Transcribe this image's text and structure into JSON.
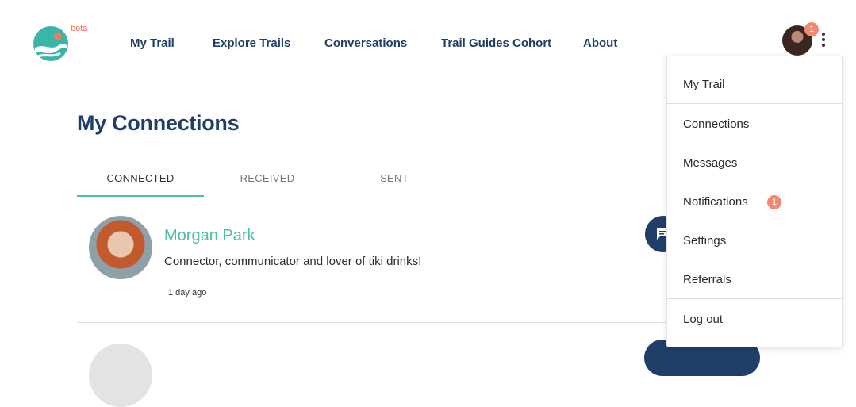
{
  "header": {
    "beta_label": "beta",
    "nav": [
      "My Trail",
      "Explore Trails",
      "Conversations",
      "Trail Guides Cohort",
      "About"
    ],
    "avatar_badge": "1"
  },
  "page": {
    "title": "My Connections",
    "tabs": [
      "CONNECTED",
      "RECEIVED",
      "SENT"
    ],
    "active_tab": "CONNECTED"
  },
  "connections": [
    {
      "name": "Morgan Park",
      "bio": "Connector, communicator and lover of tiki drinks!",
      "time": "1 day ago"
    }
  ],
  "menu": {
    "items": [
      "My Trail",
      "Connections",
      "Messages",
      "Notifications",
      "Settings",
      "Referrals",
      "Log out"
    ],
    "notifications_badge": "1"
  },
  "colors": {
    "brand_navy": "#1f3f68",
    "accent_teal": "#4cc0a8",
    "badge_coral": "#f08a70"
  }
}
